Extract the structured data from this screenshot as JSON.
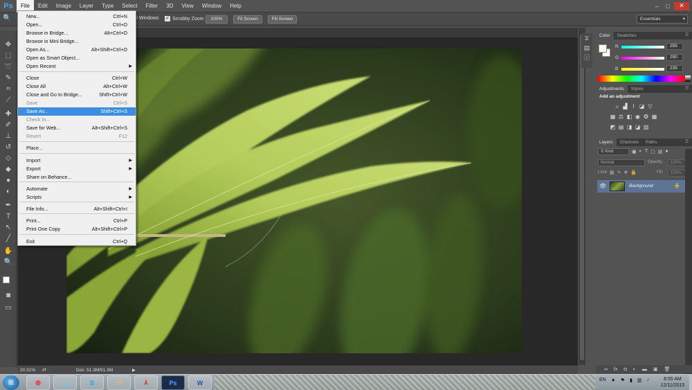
{
  "app": {
    "logo": "Ps"
  },
  "menubar": [
    "File",
    "Edit",
    "Image",
    "Layer",
    "Type",
    "Select",
    "Filter",
    "3D",
    "View",
    "Window",
    "Help"
  ],
  "options_bar": {
    "resize_windows_label": "ll Windows",
    "scrubby_zoom_label": "Scrubby Zoom",
    "scrubby_zoom_checked": true,
    "buttons": [
      "100%",
      "Fit Screen",
      "Fill Screen"
    ],
    "workspace": "Essentials"
  },
  "file_menu": {
    "items": [
      {
        "label": "New...",
        "shortcut": "Ctrl+N"
      },
      {
        "label": "Open...",
        "shortcut": "Ctrl+O"
      },
      {
        "label": "Browse in Bridge...",
        "shortcut": "Alt+Ctrl+O"
      },
      {
        "label": "Browse in Mini Bridge...",
        "shortcut": ""
      },
      {
        "label": "Open As...",
        "shortcut": "Alt+Shift+Ctrl+O"
      },
      {
        "label": "Open as Smart Object...",
        "shortcut": ""
      },
      {
        "label": "Open Recent",
        "shortcut": "",
        "submenu": true
      },
      {
        "label": "Close",
        "shortcut": "Ctrl+W"
      },
      {
        "label": "Close All",
        "shortcut": "Alt+Ctrl+W"
      },
      {
        "label": "Close and Go to Bridge...",
        "shortcut": "Shift+Ctrl+W"
      },
      {
        "label": "Save",
        "shortcut": "Ctrl+S",
        "disabled": true
      },
      {
        "label": "Save As...",
        "shortcut": "Shift+Ctrl+S",
        "highlighted": true
      },
      {
        "label": "Check In...",
        "shortcut": "",
        "disabled": true
      },
      {
        "label": "Save for Web...",
        "shortcut": "Alt+Shift+Ctrl+S"
      },
      {
        "label": "Revert",
        "shortcut": "F12",
        "disabled": true
      },
      {
        "label": "Place...",
        "shortcut": ""
      },
      {
        "label": "Import",
        "shortcut": "",
        "submenu": true
      },
      {
        "label": "Export",
        "shortcut": "",
        "submenu": true
      },
      {
        "label": "Share on Behance...",
        "shortcut": ""
      },
      {
        "label": "Automate",
        "shortcut": "",
        "submenu": true
      },
      {
        "label": "Scripts",
        "shortcut": "",
        "submenu": true
      },
      {
        "label": "File Info...",
        "shortcut": "Alt+Shift+Ctrl+I"
      },
      {
        "label": "Print...",
        "shortcut": "Ctrl+P"
      },
      {
        "label": "Print One Copy",
        "shortcut": "Alt+Shift+Ctrl+P"
      },
      {
        "label": "Exit",
        "shortcut": "Ctrl+Q"
      }
    ]
  },
  "status": {
    "zoom": "20.31%",
    "doc": "Doc: 51.3M/51.3M"
  },
  "color_panel": {
    "tabs": [
      "Color",
      "Swatches"
    ],
    "r": {
      "label": "R",
      "value": "255"
    },
    "g": {
      "label": "G",
      "value": "250"
    },
    "b": {
      "label": "B",
      "value": "235"
    },
    "foreground": "#fffaeb"
  },
  "adjustments_panel": {
    "tabs": [
      "Adjustments",
      "Styles"
    ],
    "title": "Add an adjustment"
  },
  "layers_panel": {
    "tabs": [
      "Layers",
      "Channels",
      "Paths"
    ],
    "kind": "Kind",
    "blend_mode": "Normal",
    "opacity_label": "Opacity:",
    "opacity_value": "100%",
    "lock_label": "Lock:",
    "fill_label": "Fill:",
    "fill_value": "100%",
    "layer_name": "Background"
  },
  "taskbar": {
    "language": "EN",
    "time": "8:55 AM",
    "date": "12/11/2015"
  }
}
